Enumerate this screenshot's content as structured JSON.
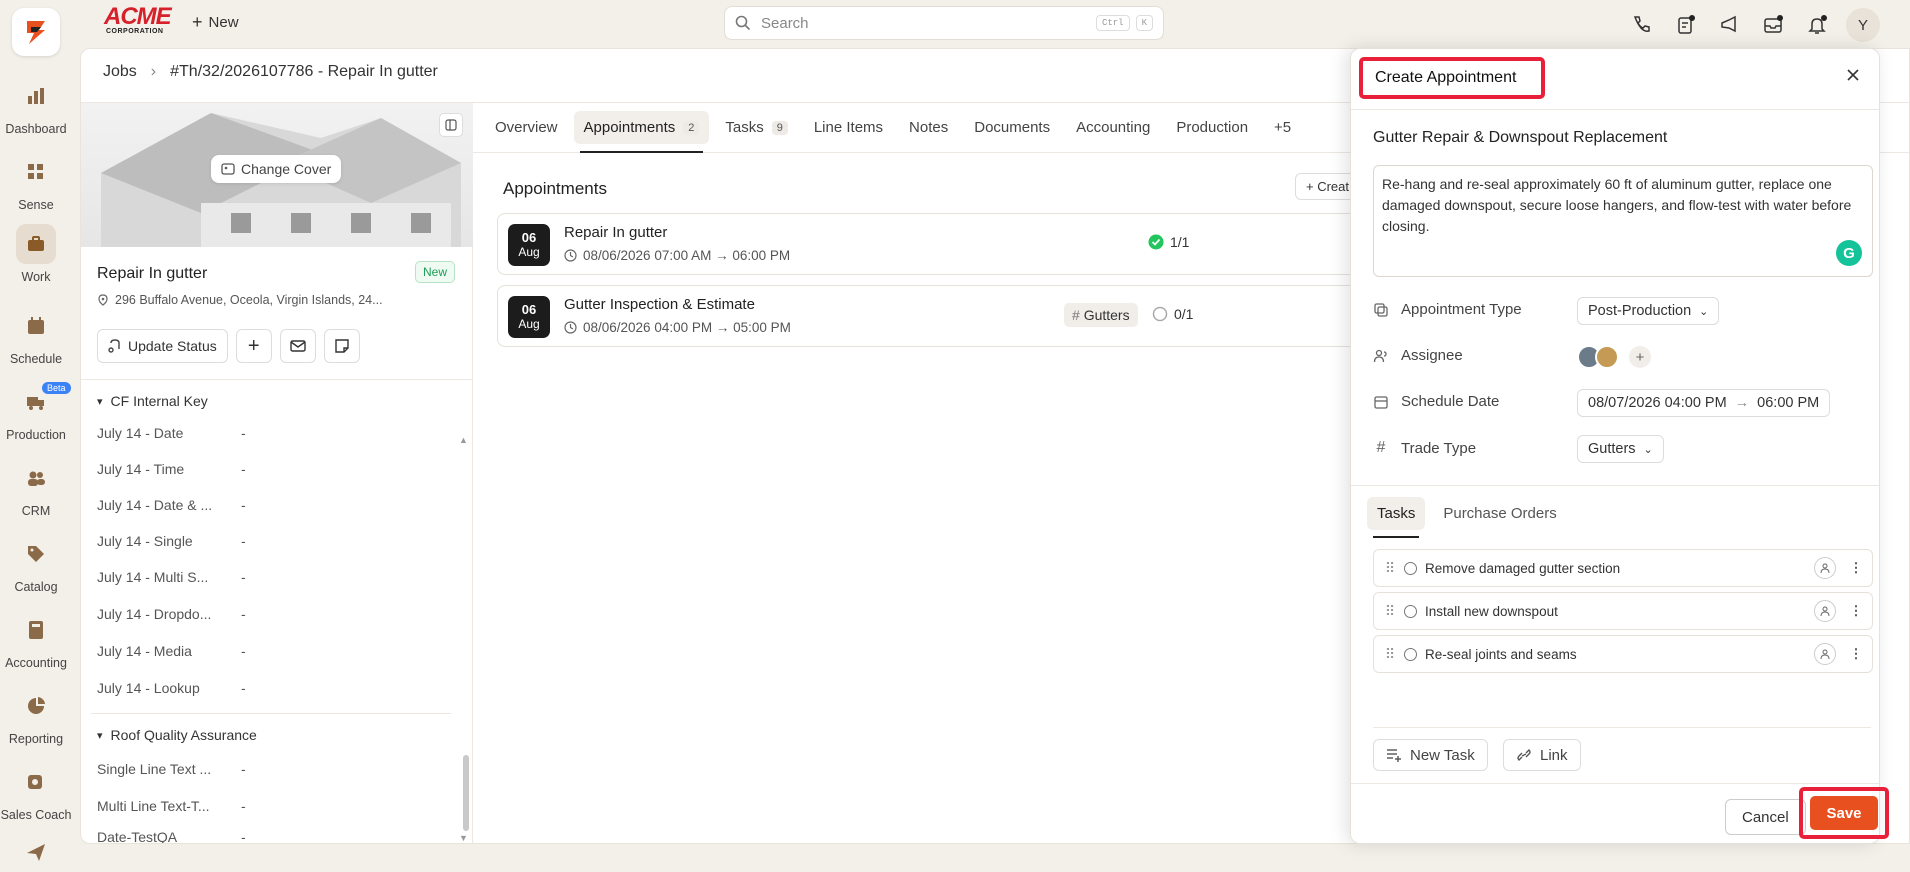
{
  "nav": {
    "items": [
      {
        "label": "Dashboard"
      },
      {
        "label": "Sense"
      },
      {
        "label": "Work"
      },
      {
        "label": "Schedule"
      },
      {
        "label": "Production",
        "badge": "Beta"
      },
      {
        "label": "CRM"
      },
      {
        "label": "Catalog"
      },
      {
        "label": "Accounting"
      },
      {
        "label": "Reporting"
      },
      {
        "label": "Sales Coach"
      }
    ]
  },
  "topbar": {
    "brand_top": "ACME",
    "brand_bottom": "CORPORATION",
    "new_label": "New",
    "search_placeholder": "Search",
    "kbd_ctrl": "Ctrl",
    "kbd_k": "K",
    "user_initial": "Y"
  },
  "breadcrumb": {
    "root": "Jobs",
    "current": "#Th/32/2026107786 - Repair In gutter"
  },
  "job": {
    "change_cover": "Change Cover",
    "title": "Repair In gutter",
    "status": "New",
    "address": "296 Buffalo Avenue, Oceola, Virgin Islands, 24...",
    "update_status": "Update Status"
  },
  "custom_fields": {
    "section1": "CF Internal Key",
    "fields1": [
      {
        "label": "July 14 - Date",
        "value": "-"
      },
      {
        "label": "July 14 - Time",
        "value": "-"
      },
      {
        "label": "July 14 - Date & ...",
        "value": "-"
      },
      {
        "label": "July 14 - Single",
        "value": "-"
      },
      {
        "label": "July 14 - Multi S...",
        "value": "-"
      },
      {
        "label": "July 14 - Dropdo...",
        "value": "-"
      },
      {
        "label": "July 14 - Media",
        "value": "-"
      },
      {
        "label": "July 14 - Lookup",
        "value": "-"
      }
    ],
    "section2": "Roof Quality Assurance",
    "fields2": [
      {
        "label": "Single Line Text ...",
        "value": "-"
      },
      {
        "label": "Multi Line Text-T...",
        "value": "-"
      },
      {
        "label": "Date-TestQA",
        "value": "-"
      }
    ]
  },
  "tabs": [
    {
      "label": "Overview"
    },
    {
      "label": "Appointments",
      "count": "2"
    },
    {
      "label": "Tasks",
      "count": "9"
    },
    {
      "label": "Line Items"
    },
    {
      "label": "Notes"
    },
    {
      "label": "Documents"
    },
    {
      "label": "Accounting"
    },
    {
      "label": "Production"
    },
    {
      "label": "+5"
    }
  ],
  "appointments": {
    "title": "Appointments",
    "create_label": "Creat",
    "items": [
      {
        "day": "06",
        "month": "Aug",
        "name": "Repair In gutter",
        "time": "08/06/2026 07:00 AM → 06:00 PM",
        "progress": "1/1"
      },
      {
        "day": "06",
        "month": "Aug",
        "name": "Gutter Inspection & Estimate",
        "time": "08/06/2026 04:00 PM → 05:00 PM",
        "trade": "Gutters",
        "progress": "0/1"
      }
    ]
  },
  "drawer": {
    "title": "Create Appointment",
    "name": "Gutter Repair & Downspout Replacement",
    "description": "Re-hang and re-seal approximately 60 ft of aluminum gutter, replace one damaged downspout, secure loose hangers, and flow-test with water before closing.",
    "grammarly": "G",
    "props": {
      "type_label": "Appointment Type",
      "type_value": "Post-Production",
      "assignee_label": "Assignee",
      "schedule_label": "Schedule Date",
      "schedule_start": "08/07/2026 04:00 PM",
      "schedule_end": "06:00 PM",
      "trade_label": "Trade Type",
      "trade_value": "Gutters"
    },
    "tabs": [
      {
        "label": "Tasks"
      },
      {
        "label": "Purchase Orders"
      }
    ],
    "tasks": [
      {
        "name": "Remove damaged gutter section"
      },
      {
        "name": "Install new downspout"
      },
      {
        "name": "Re-seal joints and seams"
      }
    ],
    "new_task": "New Task",
    "link": "Link",
    "cancel": "Cancel",
    "save": "Save"
  },
  "colors": {
    "accent": "#e8501f",
    "highlight": "#e8203a",
    "brand_red": "#d6212b"
  }
}
